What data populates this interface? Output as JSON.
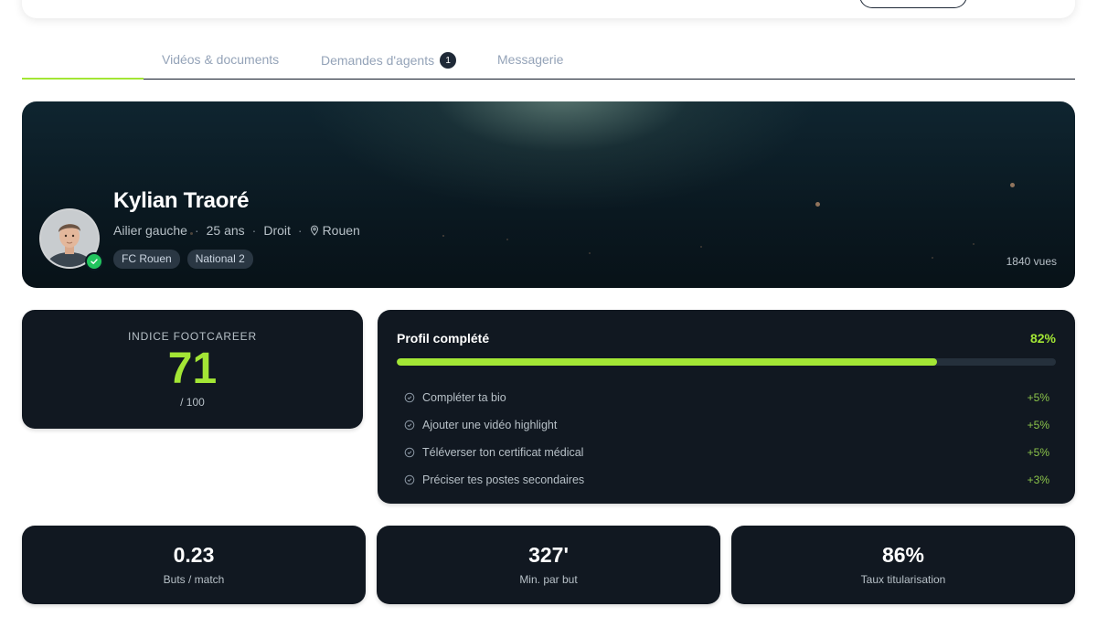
{
  "tabs": [
    {
      "label": ""
    },
    {
      "label": "Vidéos & documents"
    },
    {
      "label": "Demandes d'agents",
      "badge": "1"
    },
    {
      "label": "Messagerie"
    }
  ],
  "player": {
    "name": "Kylian Traoré",
    "position": "Ailier gauche",
    "age": "25 ans",
    "foot": "Droit",
    "city": "Rouen",
    "club": "FC Rouen",
    "league": "National 2",
    "views": "1840 vues"
  },
  "score": {
    "label": "INDICE FOOTCAREER",
    "value": "71",
    "max": "/ 100"
  },
  "profile": {
    "title": "Profil complété",
    "percent_label": "82%",
    "progress": 0.82,
    "tasks": [
      {
        "label": "Compléter ta bio",
        "bonus": "+5%"
      },
      {
        "label": "Ajouter une vidéo highlight",
        "bonus": "+5%"
      },
      {
        "label": "Téléverser ton certificat médical",
        "bonus": "+5%"
      },
      {
        "label": "Préciser tes postes secondaires",
        "bonus": "+3%"
      }
    ]
  },
  "stats": [
    {
      "value": "0.23",
      "label": "Buts / match"
    },
    {
      "value": "327'",
      "label": "Min. par but"
    },
    {
      "value": "86%",
      "label": "Taux titularisation"
    }
  ],
  "colors": {
    "accent": "#a3e635",
    "card": "#111821",
    "verified": "#22c55e"
  },
  "icons": {
    "location": "location-pin-icon",
    "verified": "check-badge-icon",
    "task": "check-circle-icon"
  }
}
